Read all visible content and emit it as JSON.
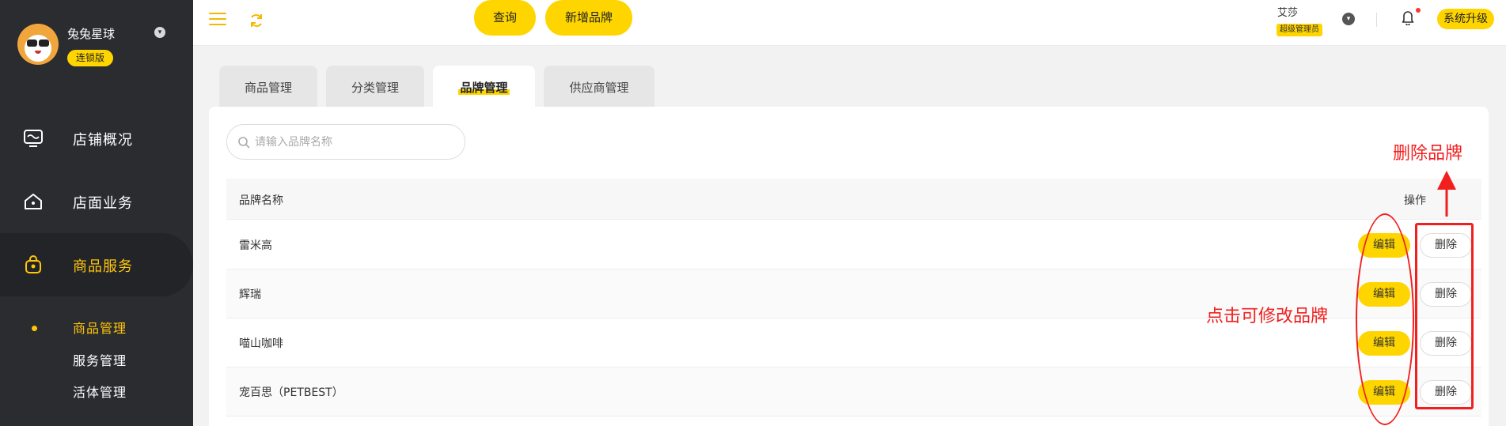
{
  "sidebar": {
    "shop_name": "兔兔星球",
    "shop_badge": "连锁版",
    "nav": [
      {
        "label": "店铺概况",
        "icon": "monitor-icon"
      },
      {
        "label": "店面业务",
        "icon": "home-icon"
      },
      {
        "label": "商品服务",
        "icon": "shopping-bag-icon",
        "active": true
      }
    ],
    "sub_nav": [
      {
        "label": "商品管理",
        "active": true
      },
      {
        "label": "服务管理"
      },
      {
        "label": "活体管理"
      }
    ]
  },
  "header": {
    "user_name": "艾莎",
    "user_role": "超级管理员",
    "upgrade_label": "系统升级"
  },
  "tabs": [
    {
      "label": "商品管理"
    },
    {
      "label": "分类管理"
    },
    {
      "label": "品牌管理",
      "active": true
    },
    {
      "label": "供应商管理"
    }
  ],
  "toolbar": {
    "search_placeholder": "请输入品牌名称",
    "query_label": "查询",
    "add_label": "新增品牌"
  },
  "table": {
    "columns": [
      "品牌名称",
      "操作"
    ],
    "rows": [
      {
        "name": "雷米高"
      },
      {
        "name": "辉瑞"
      },
      {
        "name": "喵山咖啡"
      },
      {
        "name": "宠百思（PETBEST）"
      }
    ],
    "edit_label": "编辑",
    "delete_label": "删除"
  },
  "annotations": {
    "edit_note": "点击可修改品牌",
    "delete_note": "删除品牌"
  },
  "colors": {
    "accent": "#ffd500",
    "sidebar_bg": "#2b2c30",
    "active_text": "#ffc60a",
    "annotation_red": "#f21f1f"
  }
}
